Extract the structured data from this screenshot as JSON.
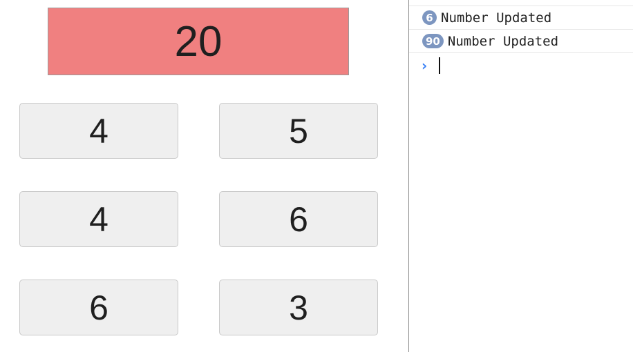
{
  "game": {
    "target": "20",
    "buttons": [
      "4",
      "5",
      "4",
      "6",
      "6",
      "3"
    ]
  },
  "console": {
    "logs": [
      {
        "count": "6",
        "message": "Number Updated"
      },
      {
        "count": "90",
        "message": "Number Updated"
      }
    ],
    "prompt_icon": "chevron-right-icon"
  },
  "colors": {
    "target_background": "#f08080",
    "button_background": "#efefef",
    "badge_background": "#7d96c0",
    "prompt_accent": "#3b82f6"
  }
}
